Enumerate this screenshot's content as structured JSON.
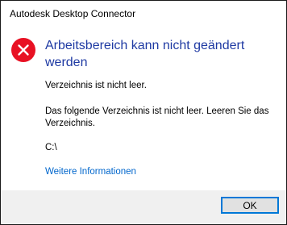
{
  "window": {
    "title": "Autodesk Desktop Connector"
  },
  "icon": {
    "name": "error-icon",
    "color": "#e81123"
  },
  "dialog": {
    "heading": "Arbeitsbereich kann nicht geändert werden",
    "message_1": "Verzeichnis ist nicht leer.",
    "message_2": "Das folgende Verzeichnis ist nicht leer. Leeren Sie das Verzeichnis.",
    "path": "C:\\",
    "more_info_link": "Weitere Informationen"
  },
  "footer": {
    "ok_label": "OK"
  },
  "colors": {
    "heading": "#1f3aa3",
    "link": "#0066cc",
    "footer_bg": "#f0f0f0",
    "button_border": "#0078d7"
  }
}
